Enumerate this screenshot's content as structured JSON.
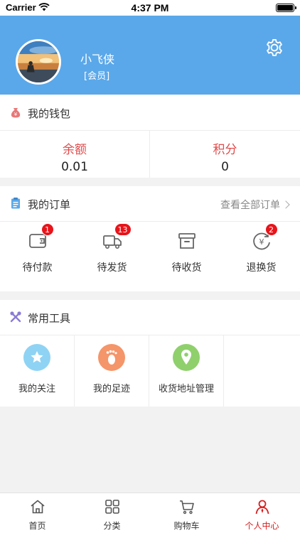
{
  "status_bar": {
    "carrier": "Carrier",
    "time": "4:37 PM"
  },
  "profile": {
    "username": "小飞侠",
    "member_tag": "[会员]"
  },
  "wallet": {
    "title": "我的钱包",
    "balance_label": "余额",
    "balance_value": "0.01",
    "points_label": "积分",
    "points_value": "0"
  },
  "orders": {
    "title": "我的订单",
    "view_all": "查看全部订单",
    "items": [
      {
        "label": "待付款",
        "badge": "1",
        "icon": "wallet-icon"
      },
      {
        "label": "待发货",
        "badge": "13",
        "icon": "truck-icon"
      },
      {
        "label": "待收货",
        "badge": "",
        "icon": "box-icon"
      },
      {
        "label": "退换货",
        "badge": "2",
        "icon": "refund-icon"
      }
    ]
  },
  "tools": {
    "title": "常用工具",
    "items": [
      {
        "label": "我的关注",
        "icon": "star-icon",
        "color": "#8fd3f4"
      },
      {
        "label": "我的足迹",
        "icon": "footprint-icon",
        "color": "#f5956a"
      },
      {
        "label": "收货地址管理",
        "icon": "location-icon",
        "color": "#8fd06c"
      }
    ]
  },
  "tabbar": {
    "items": [
      {
        "label": "首页",
        "icon": "home-icon"
      },
      {
        "label": "分类",
        "icon": "category-icon"
      },
      {
        "label": "购物车",
        "icon": "cart-icon"
      },
      {
        "label": "个人中心",
        "icon": "user-icon"
      }
    ],
    "active_index": 3,
    "active_color": "#d81e1e"
  },
  "colors": {
    "header": "#5aa8ea",
    "accent_red": "#e04b4b",
    "badge": "#e8141a"
  }
}
